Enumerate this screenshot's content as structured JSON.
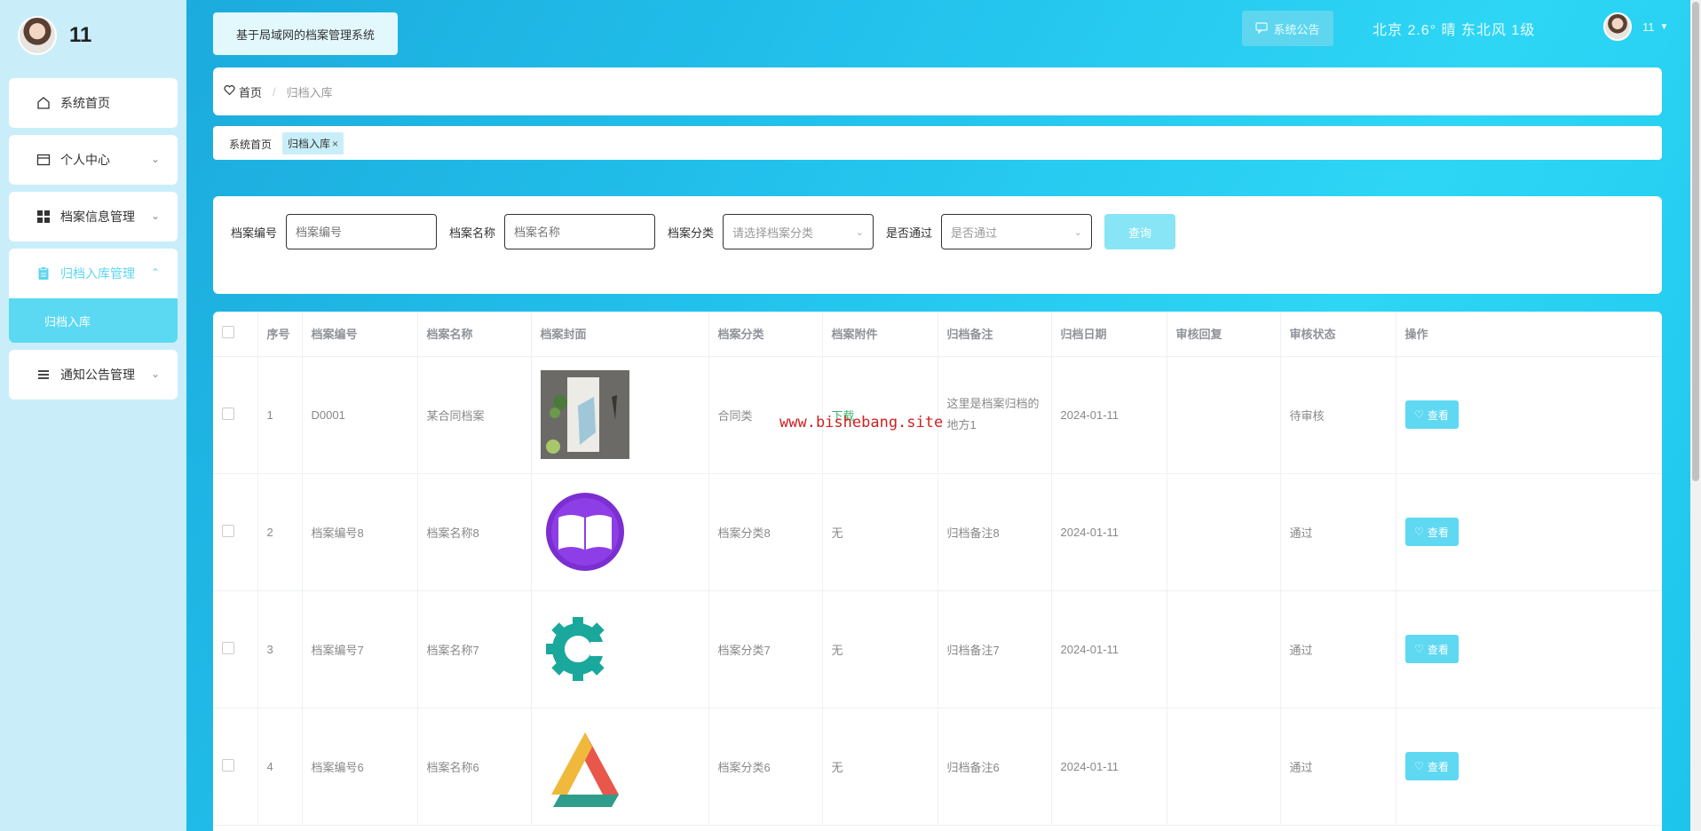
{
  "sidebar": {
    "username": "11",
    "items": [
      {
        "label": "系统首页",
        "icon": "home-icon"
      },
      {
        "label": "个人中心",
        "icon": "card-icon"
      },
      {
        "label": "档案信息管理",
        "icon": "grid-icon"
      },
      {
        "label": "归档入库管理",
        "icon": "clipboard-icon",
        "active": true,
        "sub": [
          {
            "label": "归档入库"
          }
        ]
      },
      {
        "label": "通知公告管理",
        "icon": "list-icon"
      }
    ]
  },
  "header": {
    "app_title": "基于局域网的档案管理系统",
    "notice_label": "系统公告",
    "weather": "北京  2.6°  晴  东北风  1级",
    "username": "11"
  },
  "breadcrumb": {
    "home": "首页",
    "sep": "/",
    "current": "归档入库"
  },
  "tags": {
    "home": "系统首页",
    "active": "归档入库",
    "close": "×"
  },
  "search": {
    "code_label": "档案编号",
    "code_placeholder": "档案编号",
    "name_label": "档案名称",
    "name_placeholder": "档案名称",
    "category_label": "档案分类",
    "category_placeholder": "请选择档案分类",
    "passed_label": "是否通过",
    "passed_placeholder": "是否通过",
    "query_label": "查询"
  },
  "table": {
    "headers": [
      "序号",
      "档案编号",
      "档案名称",
      "档案封面",
      "档案分类",
      "档案附件",
      "归档备注",
      "归档日期",
      "审核回复",
      "审核状态",
      "操作"
    ],
    "view_label": "查看",
    "rows": [
      {
        "no": "1",
        "code": "D0001",
        "name": "某合同档案",
        "cover": "photo",
        "category": "合同类",
        "attachment": "下载",
        "note": "这里是档案归档的地方1",
        "date": "2024-01-11",
        "reply": "",
        "status": "待审核"
      },
      {
        "no": "2",
        "code": "档案编号8",
        "name": "档案名称8",
        "cover": "book-logo",
        "category": "档案分类8",
        "attachment": "无",
        "note": "归档备注8",
        "date": "2024-01-11",
        "reply": "",
        "status": "通过"
      },
      {
        "no": "3",
        "code": "档案编号7",
        "name": "档案名称7",
        "cover": "gear-logo",
        "category": "档案分类7",
        "attachment": "无",
        "note": "归档备注7",
        "date": "2024-01-11",
        "reply": "",
        "status": "通过"
      },
      {
        "no": "4",
        "code": "档案编号6",
        "name": "档案名称6",
        "cover": "triangle-logo",
        "category": "档案分类6",
        "attachment": "无",
        "note": "归档备注6",
        "date": "2024-01-11",
        "reply": "",
        "status": "通过"
      }
    ]
  },
  "watermark": "www.bishebang.site",
  "colors": {
    "accent": "#5fd8f2",
    "sidebar_bg": "#c9eef9",
    "download": "#3cb371",
    "watermark": "#cc2222"
  }
}
